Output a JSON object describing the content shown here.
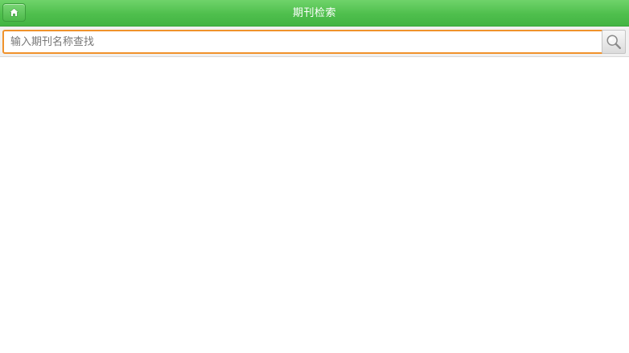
{
  "header": {
    "title": "期刊检索",
    "home_icon": "home-icon",
    "background_color": "#4fbf4d"
  },
  "search": {
    "value": "",
    "placeholder": "输入期刊名称查找",
    "button_icon": "magnifier-icon",
    "accent_color": "#f0922b"
  },
  "results": {
    "items": []
  }
}
